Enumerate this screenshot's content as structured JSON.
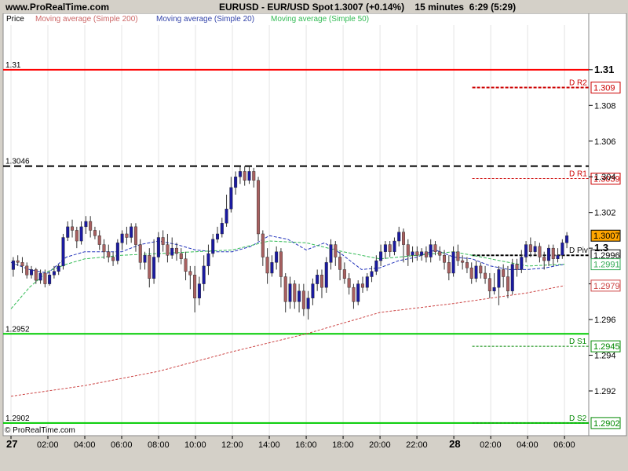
{
  "header": {
    "site": "www.ProRealTime.com",
    "symbol": "EURUSD - EUR/USD Spot",
    "price_change": "1.3007 (+0.14%)",
    "timeframe": "15 minutes",
    "clock": "6:29 (5:29)"
  },
  "legend": {
    "price": "Price",
    "ma200": "Moving average (Simple 200)",
    "ma20": "Moving average (Simple 20)",
    "ma50": "Moving average (Simple 50)"
  },
  "footer": {
    "copyright": "© ProRealTime.com"
  },
  "colors": {
    "up": "#1a1aa0",
    "down": "#a86060",
    "ma200": "#cc4444",
    "ma20": "#2233bb",
    "ma50": "#33bb55",
    "resistance": "#ff0000",
    "support": "#00cc00"
  },
  "chart_data": {
    "type": "candlestick",
    "ylim": [
      1.2898,
      1.3125
    ],
    "yticks": [
      "1.31",
      "1.308",
      "1.306",
      "1.304",
      "1.302",
      "1.3",
      "1.298",
      "1.296",
      "1.294",
      "1.292"
    ],
    "ytick_values": [
      1.31,
      1.308,
      1.306,
      1.304,
      1.302,
      1.3,
      1.298,
      1.296,
      1.294,
      1.292
    ],
    "xticks": [
      "27",
      "02:00",
      "04:00",
      "06:00",
      "08:00",
      "10:00",
      "12:00",
      "14:00",
      "16:00",
      "18:00",
      "20:00",
      "22:00",
      "28",
      "02:00",
      "04:00",
      "06:00"
    ],
    "xtick_hours": [
      0,
      2,
      4,
      6,
      8,
      10,
      12,
      14,
      16,
      18,
      20,
      22,
      24,
      26,
      28,
      30
    ],
    "horizontal_lines": [
      {
        "label": "1.31",
        "value": 1.31,
        "style": "solid",
        "color": "#ff0000"
      },
      {
        "label": "1.3046",
        "value": 1.3046,
        "style": "dashed",
        "color": "#000000"
      },
      {
        "label": "1.2952",
        "value": 1.2952,
        "style": "solid",
        "color": "#00cc00"
      },
      {
        "label": "1.2902",
        "value": 1.2902,
        "style": "solid",
        "color": "#00cc00"
      }
    ],
    "pivots": [
      {
        "name": "D R2",
        "value": 1.309,
        "value_label": "1.309",
        "color": "#cc0000",
        "dash": "4,2",
        "width": 2
      },
      {
        "name": "D R1",
        "value": 1.3039,
        "value_label": "1.3039",
        "color": "#cc0000",
        "dash": "3,2",
        "width": 1
      },
      {
        "name": "D Piv",
        "value": 1.2996,
        "value_label": "1.2996",
        "color": "#000000",
        "dash": "4,2",
        "width": 2
      },
      {
        "name": "D S1",
        "value": 1.2945,
        "value_label": "1.2945",
        "color": "#008800",
        "dash": "3,2",
        "width": 1
      },
      {
        "name": "D S2",
        "value": 1.2902,
        "value_label": "1.2902",
        "color": "#008800",
        "dash": "3,2",
        "width": 1
      }
    ],
    "pivot_start_hour": 25,
    "price_labels": [
      {
        "label": "1.3",
        "value": 1.3,
        "type": "tick"
      },
      {
        "label": "1.3007",
        "value": 1.3007,
        "type": "current"
      },
      {
        "label": "1.2991",
        "value": 1.2991,
        "type": "ma50"
      },
      {
        "label": "1.2979",
        "value": 1.2979,
        "type": "ma200"
      }
    ],
    "ma200": {
      "name": "Moving average (Simple 200)",
      "points": [
        [
          0,
          1.2917
        ],
        [
          4,
          1.2923
        ],
        [
          8,
          1.2931
        ],
        [
          12,
          1.2942
        ],
        [
          16,
          1.2952
        ],
        [
          18,
          1.2958
        ],
        [
          20,
          1.2964
        ],
        [
          24,
          1.2969
        ],
        [
          28,
          1.2975
        ],
        [
          30,
          1.2979
        ]
      ]
    },
    "ma20": {
      "name": "Moving average (Simple 20)",
      "points": [
        [
          0,
          1.2992
        ],
        [
          1,
          1.2988
        ],
        [
          2,
          1.2986
        ],
        [
          3,
          1.2995
        ],
        [
          4,
          1.2998
        ],
        [
          5,
          1.2998
        ],
        [
          6,
          1.2998
        ],
        [
          7,
          1.3002
        ],
        [
          8,
          1.3004
        ],
        [
          9,
          1.3002
        ],
        [
          10,
          1.2999
        ],
        [
          11,
          1.2998
        ],
        [
          12,
          1.2998
        ],
        [
          13,
          1.3001
        ],
        [
          14,
          1.3007
        ],
        [
          15,
          1.3005
        ],
        [
          16,
          1.2999
        ],
        [
          17,
          1.3003
        ],
        [
          18,
          1.2996
        ],
        [
          19,
          1.2988
        ],
        [
          20,
          1.2989
        ],
        [
          21,
          1.2993
        ],
        [
          22,
          1.2995
        ],
        [
          23,
          1.2999
        ],
        [
          24,
          1.2995
        ],
        [
          25,
          1.2994
        ],
        [
          26,
          1.299
        ],
        [
          27,
          1.2988
        ],
        [
          28,
          1.2988
        ],
        [
          29,
          1.2989
        ],
        [
          30,
          1.2991
        ]
      ]
    },
    "ma50": {
      "name": "Moving average (Simple 50)",
      "points": [
        [
          0,
          1.2966
        ],
        [
          1,
          1.2978
        ],
        [
          2,
          1.2987
        ],
        [
          3,
          1.2991
        ],
        [
          4,
          1.2994
        ],
        [
          5,
          1.2995
        ],
        [
          6,
          1.2996
        ],
        [
          8,
          1.2997
        ],
        [
          10,
          1.2998
        ],
        [
          12,
          1.2999
        ],
        [
          14,
          1.3004
        ],
        [
          16,
          1.3003
        ],
        [
          18,
          1.2998
        ],
        [
          20,
          1.2994
        ],
        [
          22,
          1.2996
        ],
        [
          24,
          1.2998
        ],
        [
          26,
          1.2994
        ],
        [
          28,
          1.299
        ],
        [
          30,
          1.2991
        ]
      ]
    },
    "candles": [
      [
        1.2988,
        1.2993,
        1.2984,
        1.2995
      ],
      [
        1.2993,
        1.2992,
        1.299,
        1.2996
      ],
      [
        1.2992,
        1.299,
        1.2986,
        1.2995
      ],
      [
        1.299,
        1.2985,
        1.2983,
        1.2992
      ],
      [
        1.2985,
        1.2988,
        1.2983,
        1.299
      ],
      [
        1.2988,
        1.2982,
        1.298,
        1.2989
      ],
      [
        1.2982,
        1.2986,
        1.298,
        1.2988
      ],
      [
        1.2986,
        1.298,
        1.2978,
        1.2988
      ],
      [
        1.298,
        1.2985,
        1.2979,
        1.2987
      ],
      [
        1.2985,
        1.2987,
        1.2983,
        1.299
      ],
      [
        1.2987,
        1.299,
        1.2985,
        1.2991
      ],
      [
        1.299,
        1.3006,
        1.2988,
        1.3008
      ],
      [
        1.3006,
        1.3012,
        1.3004,
        1.3015
      ],
      [
        1.3012,
        1.301,
        1.3006,
        1.3016
      ],
      [
        1.301,
        1.3004,
        1.3,
        1.3012
      ],
      [
        1.3004,
        1.3012,
        1.3002,
        1.3015
      ],
      [
        1.3012,
        1.3015,
        1.3008,
        1.3018
      ],
      [
        1.3015,
        1.301,
        1.3006,
        1.3018
      ],
      [
        1.301,
        1.3007,
        1.3005,
        1.3012
      ],
      [
        1.3007,
        1.3002,
        1.2999,
        1.301
      ],
      [
        1.3002,
        1.2998,
        1.2994,
        1.3005
      ],
      [
        1.2998,
        1.2995,
        1.2992,
        1.3002
      ],
      [
        1.2995,
        1.2993,
        1.299,
        1.2998
      ],
      [
        1.2993,
        1.3003,
        1.2991,
        1.3005
      ],
      [
        1.3003,
        1.3008,
        1.2999,
        1.301
      ],
      [
        1.3008,
        1.3006,
        1.3002,
        1.3012
      ],
      [
        1.3006,
        1.3012,
        1.3003,
        1.3014
      ],
      [
        1.3012,
        1.3002,
        1.2998,
        1.3014
      ],
      [
        1.3002,
        1.2992,
        1.2988,
        1.3005
      ],
      [
        1.2992,
        1.2996,
        1.2988,
        1.2998
      ],
      [
        1.2996,
        1.2983,
        1.2978,
        1.3
      ],
      [
        1.2983,
        1.2995,
        1.298,
        1.3005
      ],
      [
        1.2995,
        1.3006,
        1.2992,
        1.3009
      ],
      [
        1.3006,
        1.3002,
        1.2998,
        1.301
      ],
      [
        1.3002,
        1.2996,
        1.2992,
        1.3008
      ],
      [
        1.2996,
        1.3,
        1.2994,
        1.3006
      ],
      [
        1.3,
        1.2997,
        1.2993,
        1.3003
      ],
      [
        1.2997,
        1.2994,
        1.2991,
        1.3
      ],
      [
        1.2994,
        1.2987,
        1.2982,
        1.2998
      ],
      [
        1.2987,
        1.2985,
        1.2977,
        1.299
      ],
      [
        1.2985,
        1.2972,
        1.2964,
        1.299
      ],
      [
        1.2972,
        1.298,
        1.2968,
        1.2984
      ],
      [
        1.298,
        1.299,
        1.2976,
        1.2996
      ],
      [
        1.299,
        1.2997,
        1.2985,
        1.3002
      ],
      [
        1.2997,
        1.3005,
        1.2995,
        1.3008
      ],
      [
        1.3005,
        1.3008,
        1.3003,
        1.3012
      ],
      [
        1.3008,
        1.3014,
        1.3006,
        1.3017
      ],
      [
        1.3014,
        1.3022,
        1.3012,
        1.303
      ],
      [
        1.3022,
        1.3034,
        1.302,
        1.304
      ],
      [
        1.3034,
        1.304,
        1.303,
        1.3043
      ],
      [
        1.304,
        1.3043,
        1.3036,
        1.3046
      ],
      [
        1.3043,
        1.3038,
        1.3035,
        1.3046
      ],
      [
        1.3038,
        1.3043,
        1.3036,
        1.3046
      ],
      [
        1.3043,
        1.3038,
        1.3034,
        1.3045
      ],
      [
        1.3038,
        1.3008,
        1.3004,
        1.304
      ],
      [
        1.3008,
        1.2995,
        1.299,
        1.301
      ],
      [
        1.2995,
        1.2986,
        1.298,
        1.3
      ],
      [
        1.2986,
        1.2992,
        1.2984,
        1.2996
      ],
      [
        1.2992,
        1.2998,
        1.2988,
        1.3001
      ],
      [
        1.2998,
        1.2984,
        1.2978,
        1.3
      ],
      [
        1.2984,
        1.297,
        1.2964,
        1.2986
      ],
      [
        1.297,
        1.298,
        1.2966,
        1.2984
      ],
      [
        1.298,
        1.297,
        1.2966,
        1.2982
      ],
      [
        1.297,
        1.2976,
        1.2964,
        1.298
      ],
      [
        1.2976,
        1.2966,
        1.2962,
        1.298
      ],
      [
        1.2966,
        1.2972,
        1.296,
        1.2976
      ],
      [
        1.2972,
        1.298,
        1.2968,
        1.2983
      ],
      [
        1.298,
        1.2985,
        1.2976,
        1.2988
      ],
      [
        1.2985,
        1.2978,
        1.2972,
        1.2988
      ],
      [
        1.2978,
        1.2992,
        1.2975,
        1.2995
      ],
      [
        1.2992,
        1.3002,
        1.2988,
        1.3005
      ],
      [
        1.3002,
        1.2995,
        1.299,
        1.3004
      ],
      [
        1.2995,
        1.2988,
        1.2982,
        1.2998
      ],
      [
        1.2988,
        1.2983,
        1.298,
        1.2992
      ],
      [
        1.2983,
        1.2978,
        1.2974,
        1.2986
      ],
      [
        1.2978,
        1.297,
        1.2966,
        1.298
      ],
      [
        1.297,
        1.298,
        1.2968,
        1.2982
      ],
      [
        1.298,
        1.2978,
        1.2975,
        1.2984
      ],
      [
        1.2978,
        1.2984,
        1.2976,
        1.2986
      ],
      [
        1.2984,
        1.2987,
        1.2981,
        1.299
      ],
      [
        1.2987,
        1.2993,
        1.2985,
        1.2996
      ],
      [
        1.2993,
        1.2998,
        1.299,
        1.3002
      ],
      [
        1.2998,
        1.3002,
        1.2994,
        1.3004
      ],
      [
        1.3002,
        1.2998,
        1.2995,
        1.3004
      ],
      [
        1.2998,
        1.3004,
        1.2996,
        1.3006
      ],
      [
        1.3004,
        1.3009,
        1.3001,
        1.3012
      ],
      [
        1.3009,
        1.3002,
        1.2992,
        1.3011
      ],
      [
        1.3002,
        1.2996,
        1.299,
        1.3005
      ],
      [
        1.2996,
        1.2998,
        1.2992,
        1.3001
      ],
      [
        1.2998,
        1.2996,
        1.2993,
        1.3001
      ],
      [
        1.2996,
        1.2998,
        1.2993,
        1.3
      ],
      [
        1.2998,
        1.2995,
        1.2992,
        1.3001
      ],
      [
        1.2995,
        1.3002,
        1.2992,
        1.3005
      ],
      [
        1.3002,
        1.2998,
        1.2996,
        1.3004
      ],
      [
        1.2998,
        1.2996,
        1.2993,
        1.3001
      ],
      [
        1.2996,
        1.2992,
        1.2988,
        1.2999
      ],
      [
        1.2992,
        1.2986,
        1.2982,
        1.2996
      ],
      [
        1.2986,
        1.2998,
        1.2984,
        1.3001
      ],
      [
        1.2998,
        1.2993,
        1.299,
        1.3002
      ],
      [
        1.2993,
        1.2992,
        1.2988,
        1.2996
      ],
      [
        1.2992,
        1.2989,
        1.2986,
        1.2995
      ],
      [
        1.2989,
        1.2983,
        1.298,
        1.2992
      ],
      [
        1.2983,
        1.299,
        1.2981,
        1.2993
      ],
      [
        1.299,
        1.2986,
        1.2983,
        1.2992
      ],
      [
        1.2986,
        1.2983,
        1.298,
        1.299
      ],
      [
        1.2983,
        1.2976,
        1.2972,
        1.2986
      ],
      [
        1.2976,
        1.2978,
        1.2974,
        1.2986
      ],
      [
        1.2978,
        1.2988,
        1.2968,
        1.299
      ],
      [
        1.2988,
        1.2984,
        1.2978,
        1.2991
      ],
      [
        1.2984,
        1.2976,
        1.2972,
        1.299
      ],
      [
        1.2976,
        1.2991,
        1.2974,
        1.2994
      ],
      [
        1.2991,
        1.2988,
        1.2984,
        1.2994
      ],
      [
        1.2988,
        1.2995,
        1.2986,
        1.2999
      ],
      [
        1.2995,
        1.3002,
        1.2992,
        1.3004
      ],
      [
        1.3002,
        1.2998,
        1.2995,
        1.3006
      ],
      [
        1.2998,
        1.3001,
        1.2996,
        1.3004
      ],
      [
        1.3001,
        1.2995,
        1.2992,
        1.3003
      ],
      [
        1.2995,
        1.2993,
        1.2988,
        1.2998
      ],
      [
        1.2993,
        1.3,
        1.299,
        1.3002
      ],
      [
        1.3,
        1.2994,
        1.299,
        1.3002
      ],
      [
        1.2994,
        1.2996,
        1.2992,
        1.3
      ],
      [
        1.2996,
        1.3003,
        1.2994,
        1.3005
      ],
      [
        1.3003,
        1.3007,
        1.3,
        1.3009
      ]
    ]
  }
}
